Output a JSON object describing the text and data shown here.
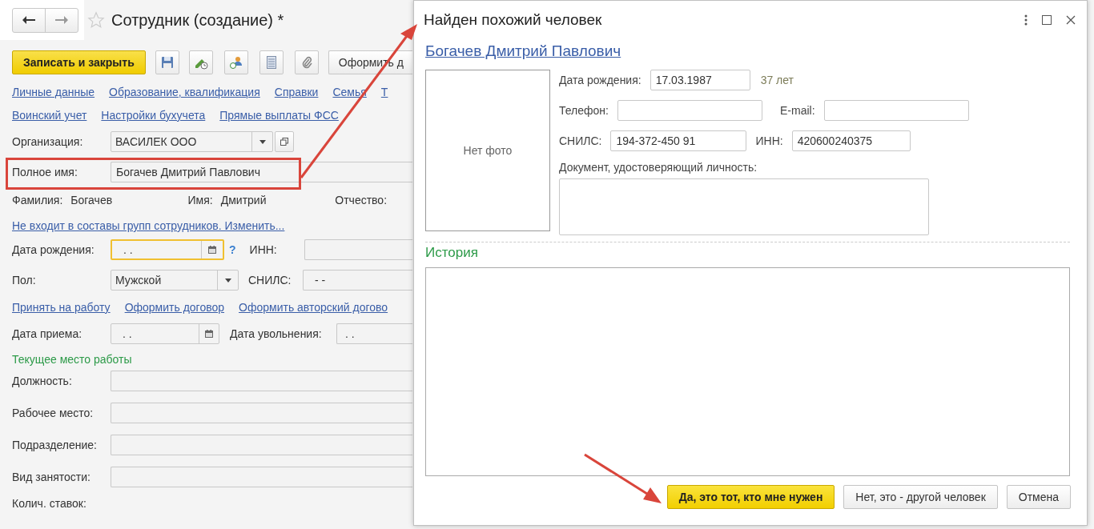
{
  "form": {
    "title": "Сотрудник (создание) *",
    "favorite": false,
    "toolbar": {
      "primary": "Записать и закрыть",
      "secondary": "Оформить д"
    },
    "links_row_1": [
      "Личные данные",
      "Образование, квалификация",
      "Справки",
      "Семья",
      "Т"
    ],
    "links_row_2": [
      "Воинский учет",
      "Настройки бухучета",
      "Прямые выплаты ФСС"
    ],
    "organization": {
      "label": "Организация:",
      "value": "ВАСИЛЕК ООО"
    },
    "full_name": {
      "label": "Полное имя:",
      "value": "Богачев Дмитрий Павлович",
      "highlighted": true
    },
    "name_parts": [
      {
        "label": "Фамилия:",
        "value": "Богачев"
      },
      {
        "label": "Имя:",
        "value": "Дмитрий"
      },
      {
        "label": "Отчество:"
      }
    ],
    "groups_link": "Не входит в составы групп сотрудников. Изменить...",
    "birth_date": {
      "label": "Дата рождения:",
      "value": ". .",
      "focused": true,
      "help": "?"
    },
    "inn": {
      "label": "ИНН:"
    },
    "gender": {
      "label": "Пол:",
      "value": "Мужской"
    },
    "snils": {
      "label": "СНИЛС:",
      "value": "-  -"
    },
    "action_links": [
      "Принять на работу",
      "Оформить договор",
      "Оформить авторский догово"
    ],
    "hire_date": {
      "label": "Дата приема:",
      "value": ". ."
    },
    "dismissal_date": {
      "label": "Дата увольнения:",
      "value": ". ."
    },
    "section_title": "Текущее место работы",
    "work_fields": [
      "Должность:",
      "Рабочее место:",
      "Подразделение:",
      "Вид занятости:"
    ],
    "rate_label": "Колич. ставок:"
  },
  "dialog": {
    "title": "Найден похожий человек",
    "person_link": "Богачев Дмитрий Павлович",
    "photo_placeholder": "Нет фото",
    "birth_date": {
      "label": "Дата рождения:",
      "value": "17.03.1987",
      "age": "37 лет"
    },
    "phone": {
      "label": "Телефон:"
    },
    "email": {
      "label": "E-mail:"
    },
    "snils": {
      "label": "СНИЛС:",
      "value": "194-372-450 91"
    },
    "inn": {
      "label": "ИНН:",
      "value": "420600240375"
    },
    "document": {
      "label": "Документ, удостоверяющий личность:"
    },
    "history_title": "История",
    "buttons": [
      {
        "label": "Да, это тот, кто мне нужен",
        "primary": true
      },
      {
        "label": "Нет, это - другой человек",
        "primary": false
      },
      {
        "label": "Отмена",
        "primary": false
      }
    ]
  }
}
